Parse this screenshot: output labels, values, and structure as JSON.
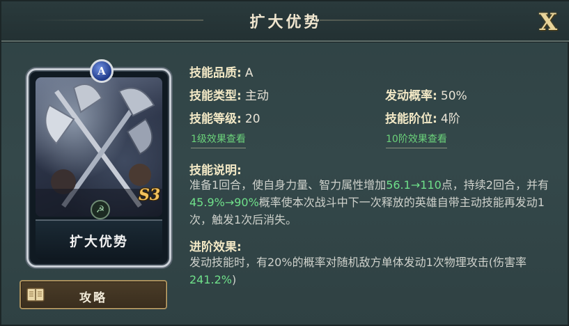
{
  "header": {
    "title": "扩大优势",
    "close_label": "X"
  },
  "card": {
    "grade_gem": "A",
    "badge": "S3",
    "name": "扩大优势",
    "icon": "crossed-axes-art",
    "faction_icon": "sickle-icon"
  },
  "guide_button": {
    "label": "攻略",
    "icon": "book-icon"
  },
  "skill": {
    "quality_label": "技能品质:",
    "quality_value": "A",
    "type_label": "技能类型:",
    "type_value": "主动",
    "chance_label": "发动概率:",
    "chance_value": "50%",
    "level_label": "技能等级:",
    "level_value": "20",
    "tier_label": "技能阶位:",
    "tier_value": "4阶",
    "link_level1": "1级效果查看",
    "link_tier10": "10阶效果查看"
  },
  "description": {
    "heading": "技能说明:",
    "text_1": "准备1回合，使自身力量、智力属性增加",
    "hl_1": "56.1→110",
    "text_2": "点，持续2回合，并有",
    "hl_2": "45.9%→90%",
    "text_3": "概率使本次战斗中下一次释放的英雄自带主动技能再发动1次，触发1次后消失。"
  },
  "advanced": {
    "heading": "进阶效果:",
    "text_1": "发动技能时，有20%的概率对随机敌方单体发动1次物理攻击(伤害率",
    "hl_1": "241.2%",
    "text_2": ")"
  },
  "colors": {
    "highlight": "#6fe08a",
    "label_gold": "#f3e9c6",
    "link_green": "#6bd27a"
  }
}
